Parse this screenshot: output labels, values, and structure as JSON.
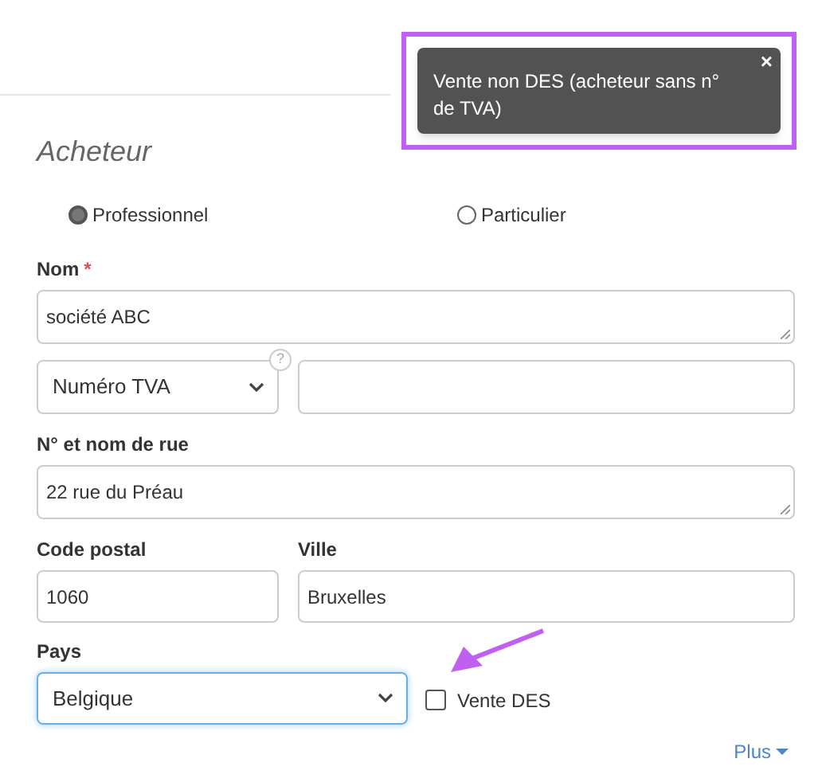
{
  "toast": {
    "text": "Vente non DES (acheteur sans n° de TVA)",
    "close": "×",
    "highlighted": true
  },
  "section_title": "Acheteur",
  "buyer_type": [
    {
      "label": "Professionnel",
      "selected": true
    },
    {
      "label": "Particulier",
      "selected": false
    }
  ],
  "name": {
    "label": "Nom",
    "required_mark": "*",
    "value": "société ABC"
  },
  "vat": {
    "type_select": "Numéro TVA",
    "help": "?"
  },
  "street": {
    "label": "N° et nom de rue",
    "value": "22 rue du Préau"
  },
  "postal_code": {
    "label": "Code postal",
    "value": "1060"
  },
  "city": {
    "label": "Ville",
    "value": "Bruxelles"
  },
  "country": {
    "label": "Pays",
    "value": "Belgique",
    "focused": true
  },
  "vente_des": {
    "label": "Vente DES",
    "checked": false,
    "arrow_pointer": true
  },
  "more_link": "Plus"
}
